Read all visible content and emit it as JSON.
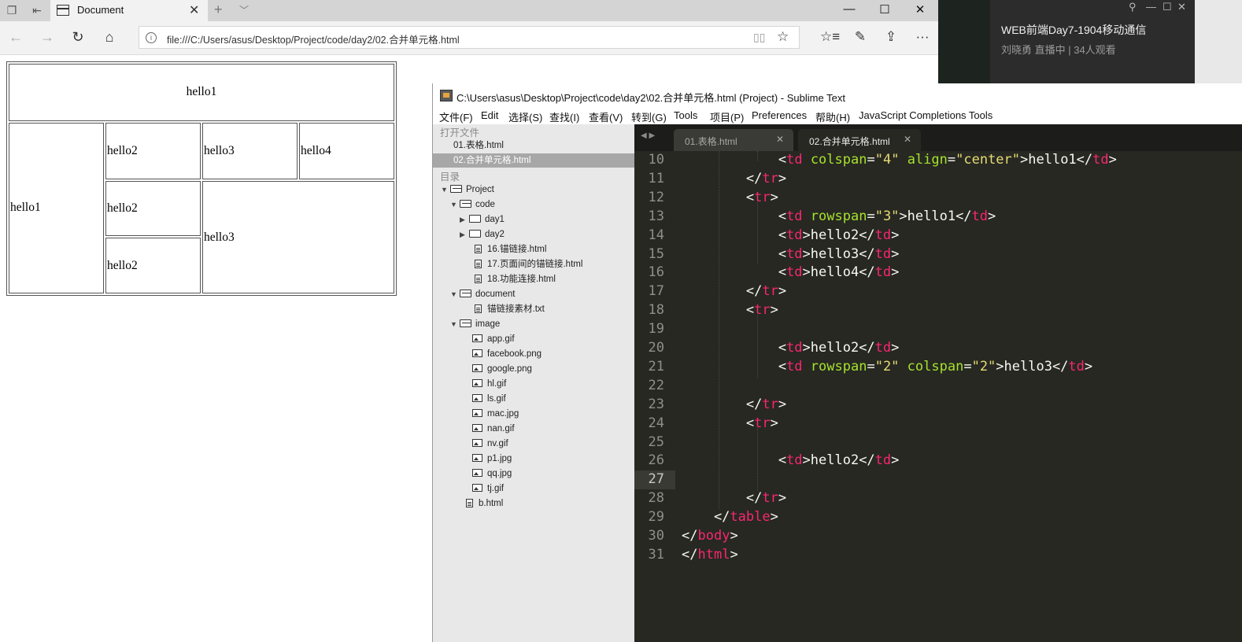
{
  "browser": {
    "tab_title": "Document",
    "url": "file:///C:/Users/asus/Desktop/Project/code/day2/02.合并单元格.html",
    "tab_close_glyph": "✕",
    "newtab_glyph": "+",
    "tabmenu_glyph": "﹀",
    "minimize_glyph": "—",
    "maximize_glyph": "☐",
    "close_glyph": "✕",
    "more_glyph": "···"
  },
  "table_cells": {
    "r1c1": "hello1",
    "r2c1": "hello1",
    "r2c2": "hello2",
    "r2c3": "hello3",
    "r2c4": "hello4",
    "r3c2": "hello2",
    "r3c3": "hello3",
    "r4c2": "hello2"
  },
  "live": {
    "title": "WEB前端Day7-1904移动通信",
    "subtitle": "刘晓勇 直播中 | 34人观看"
  },
  "sublime": {
    "title": "C:\\Users\\asus\\Desktop\\Project\\code\\day2\\02.合并单元格.html (Project) - Sublime Text",
    "menu": [
      "文件(F)",
      "Edit",
      "选择(S)",
      "查找(I)",
      "查看(V)",
      "转到(G)",
      "Tools",
      "项目(P)",
      "Preferences",
      "帮助(H)",
      "JavaScript Completions Tools"
    ],
    "sidebar": {
      "open_files_header": "打开文件",
      "open_files": [
        "01.表格.html",
        "02.合并单元格.html"
      ],
      "folders_header": "目录",
      "tree": {
        "project": "Project",
        "code": "code",
        "day1": "day1",
        "day2": "day2",
        "code_files": [
          "16.锚链接.html",
          "17.页面间的锚链接.html",
          "18.功能连接.html"
        ],
        "document": "document",
        "document_files": [
          "锚链接素材.txt"
        ],
        "image": "image",
        "image_files": [
          "app.gif",
          "facebook.png",
          "google.png",
          "hl.gif",
          "ls.gif",
          "mac.jpg",
          "nan.gif",
          "nv.gif",
          "p1.jpg",
          "qq.jpg",
          "tj.gif"
        ],
        "root_file": "b.html"
      }
    },
    "tabs": [
      "01.表格.html",
      "02.合并单元格.html"
    ],
    "current_line": "27",
    "line_numbers": [
      "10",
      "11",
      "12",
      "13",
      "14",
      "15",
      "16",
      "17",
      "18",
      "19",
      "20",
      "21",
      "22",
      "23",
      "24",
      "25",
      "26",
      "27",
      "28",
      "29",
      "30",
      "31"
    ]
  },
  "code_lines": [
    [
      {
        "t": "pl",
        "v": "            "
      },
      {
        "t": "pl",
        "v": "<"
      },
      {
        "t": "tg",
        "v": "td"
      },
      {
        "t": "pl",
        "v": " "
      },
      {
        "t": "at",
        "v": "colspan"
      },
      {
        "t": "pl",
        "v": "="
      },
      {
        "t": "st",
        "v": "\"4\""
      },
      {
        "t": "pl",
        "v": " "
      },
      {
        "t": "at",
        "v": "align"
      },
      {
        "t": "pl",
        "v": "="
      },
      {
        "t": "st",
        "v": "\"center\""
      },
      {
        "t": "pl",
        "v": ">hello1</"
      },
      {
        "t": "tg",
        "v": "td"
      },
      {
        "t": "pl",
        "v": ">"
      }
    ],
    [
      {
        "t": "pl",
        "v": "        </"
      },
      {
        "t": "tg",
        "v": "tr"
      },
      {
        "t": "pl",
        "v": ">"
      }
    ],
    [
      {
        "t": "pl",
        "v": "        <"
      },
      {
        "t": "tg",
        "v": "tr"
      },
      {
        "t": "pl",
        "v": ">"
      }
    ],
    [
      {
        "t": "pl",
        "v": "            <"
      },
      {
        "t": "tg",
        "v": "td"
      },
      {
        "t": "pl",
        "v": " "
      },
      {
        "t": "at",
        "v": "rowspan"
      },
      {
        "t": "pl",
        "v": "="
      },
      {
        "t": "st",
        "v": "\"3\""
      },
      {
        "t": "pl",
        "v": ">hello1</"
      },
      {
        "t": "tg",
        "v": "td"
      },
      {
        "t": "pl",
        "v": ">"
      }
    ],
    [
      {
        "t": "pl",
        "v": "            <"
      },
      {
        "t": "tg",
        "v": "td"
      },
      {
        "t": "pl",
        "v": ">hello2</"
      },
      {
        "t": "tg",
        "v": "td"
      },
      {
        "t": "pl",
        "v": ">"
      }
    ],
    [
      {
        "t": "pl",
        "v": "            <"
      },
      {
        "t": "tg",
        "v": "td"
      },
      {
        "t": "pl",
        "v": ">hello3</"
      },
      {
        "t": "tg",
        "v": "td"
      },
      {
        "t": "pl",
        "v": ">"
      }
    ],
    [
      {
        "t": "pl",
        "v": "            <"
      },
      {
        "t": "tg",
        "v": "td"
      },
      {
        "t": "pl",
        "v": ">hello4</"
      },
      {
        "t": "tg",
        "v": "td"
      },
      {
        "t": "pl",
        "v": ">"
      }
    ],
    [
      {
        "t": "pl",
        "v": "        </"
      },
      {
        "t": "tg",
        "v": "tr"
      },
      {
        "t": "pl",
        "v": ">"
      }
    ],
    [
      {
        "t": "pl",
        "v": "        <"
      },
      {
        "t": "tg",
        "v": "tr"
      },
      {
        "t": "pl",
        "v": ">"
      }
    ],
    [],
    [
      {
        "t": "pl",
        "v": "            <"
      },
      {
        "t": "tg",
        "v": "td"
      },
      {
        "t": "pl",
        "v": ">hello2</"
      },
      {
        "t": "tg",
        "v": "td"
      },
      {
        "t": "pl",
        "v": ">"
      }
    ],
    [
      {
        "t": "pl",
        "v": "            <"
      },
      {
        "t": "tg",
        "v": "td"
      },
      {
        "t": "pl",
        "v": " "
      },
      {
        "t": "at",
        "v": "rowspan"
      },
      {
        "t": "pl",
        "v": "="
      },
      {
        "t": "st",
        "v": "\"2\""
      },
      {
        "t": "pl",
        "v": " "
      },
      {
        "t": "at",
        "v": "colspan"
      },
      {
        "t": "pl",
        "v": "="
      },
      {
        "t": "st",
        "v": "\"2\""
      },
      {
        "t": "pl",
        "v": ">hello3</"
      },
      {
        "t": "tg",
        "v": "td"
      },
      {
        "t": "pl",
        "v": ">"
      }
    ],
    [],
    [
      {
        "t": "pl",
        "v": "        </"
      },
      {
        "t": "tg",
        "v": "tr"
      },
      {
        "t": "pl",
        "v": ">"
      }
    ],
    [
      {
        "t": "pl",
        "v": "        <"
      },
      {
        "t": "tg",
        "v": "tr"
      },
      {
        "t": "pl",
        "v": ">"
      }
    ],
    [],
    [
      {
        "t": "pl",
        "v": "            <"
      },
      {
        "t": "tg",
        "v": "td"
      },
      {
        "t": "pl",
        "v": ">hello2</"
      },
      {
        "t": "tg",
        "v": "td"
      },
      {
        "t": "pl",
        "v": ">"
      }
    ],
    [],
    [
      {
        "t": "pl",
        "v": "        </"
      },
      {
        "t": "tg",
        "v": "tr"
      },
      {
        "t": "pl",
        "v": ">"
      }
    ],
    [
      {
        "t": "pl",
        "v": "    </"
      },
      {
        "t": "tg",
        "v": "table"
      },
      {
        "t": "pl",
        "v": ">"
      }
    ],
    [
      {
        "t": "pl",
        "v": "</"
      },
      {
        "t": "tg",
        "v": "body"
      },
      {
        "t": "pl",
        "v": ">"
      }
    ],
    [
      {
        "t": "pl",
        "v": "</"
      },
      {
        "t": "tg",
        "v": "html"
      },
      {
        "t": "pl",
        "v": ">"
      }
    ]
  ],
  "syntax_colors": {
    "tag": "#f92672",
    "attr": "#a6e22e",
    "string": "#e6db74",
    "plain": "#f8f8f2",
    "background": "#272822"
  }
}
